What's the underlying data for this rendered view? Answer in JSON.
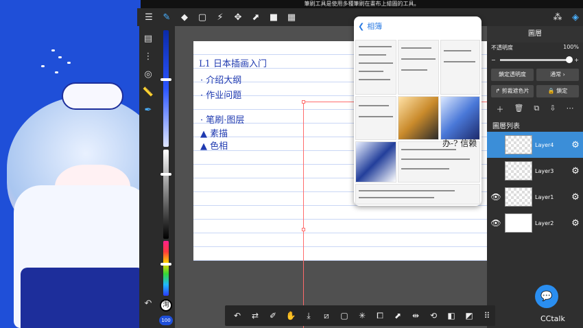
{
  "hint": "筆刷工具是使用多種筆刷在畫布上繪圖的工具。",
  "picker": {
    "back_label": "相簿",
    "scribble_title": "Lı 日本插画入门",
    "side_text": "办-? 信赖"
  },
  "notes": {
    "line1": "L1 日本插画入门",
    "line2": "· 介绍大纲",
    "line3": "· 作业问题",
    "line4": "· 笔刷·图层",
    "line5": "▲ 素描",
    "line6": "▲ 色相"
  },
  "layer_panel": {
    "title": "圖層",
    "opacity_label": "不透明度",
    "opacity_value": "100%",
    "opacity_fraction": 1.0,
    "lock_alpha_label": "鎖定透明度",
    "blend_label": "通常",
    "clip_label": "剪裁遮色片",
    "lock_label": "鎖定",
    "list_title": "圖層列表",
    "layers": [
      {
        "name": "Layer4",
        "selected": true,
        "visible": false
      },
      {
        "name": "Layer3",
        "selected": false,
        "visible": false
      },
      {
        "name": "Layer1",
        "selected": false,
        "visible": true
      },
      {
        "name": "Layer2",
        "selected": false,
        "visible": true
      }
    ]
  },
  "color": {
    "size_label": "100",
    "swatch_char": "洵"
  },
  "brand": {
    "name": "CCtalk"
  },
  "icons": {
    "top": [
      "menu-icon",
      "brush-icon",
      "eraser-icon",
      "rect-select-icon",
      "magic-wand-icon",
      "move-icon",
      "transform-icon",
      "fill-icon",
      "gradient-icon",
      "three-circles-icon",
      "layers-icon"
    ],
    "bottom": [
      "undo-icon",
      "brush-swap-icon",
      "eyedropper-icon",
      "hand-icon",
      "download-icon",
      "no-select-icon",
      "select-all-icon",
      "sparkle-icon",
      "paste-icon",
      "export-icon",
      "flip-icon",
      "rotate-lock-icon",
      "eraser-icon",
      "eyedropper2-icon",
      "grid-icon"
    ]
  },
  "colors": {
    "accent": "#3b8ed8",
    "bg_blue": "#1f4fd8",
    "note_blue": "#1f3ab0"
  }
}
